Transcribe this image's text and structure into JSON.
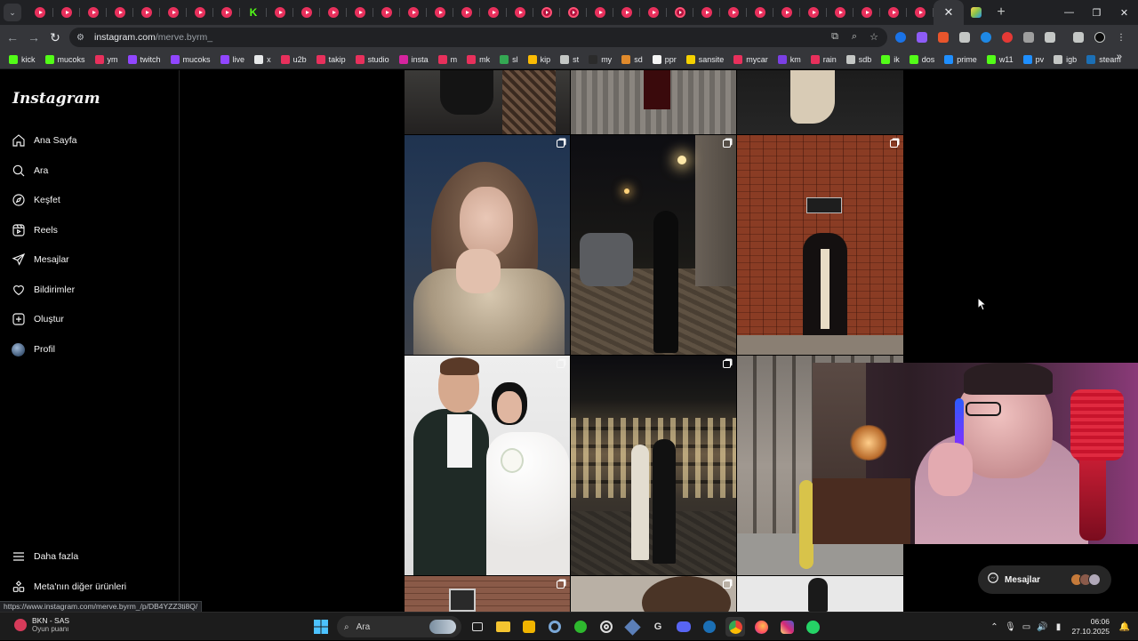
{
  "browser": {
    "url_host": "instagram.com",
    "url_path": "/merve.byrm_",
    "close_tab_glyph": "✕",
    "new_tab_glyph": "+",
    "status_url": "https://www.instagram.com/merve.byrm_/p/DB4YZZ3ti8Q/"
  },
  "bookmarks": [
    {
      "label": "kick",
      "color": "#53fc18"
    },
    {
      "label": "mucoks",
      "color": "#53fc18"
    },
    {
      "label": "ym",
      "color": "#e8305c"
    },
    {
      "label": "twitch",
      "color": "#9146ff"
    },
    {
      "label": "mucoks",
      "color": "#9146ff"
    },
    {
      "label": "live",
      "color": "#9146ff"
    },
    {
      "label": "x",
      "color": "#e7e9ea"
    },
    {
      "label": "u2b",
      "color": "#e8305c"
    },
    {
      "label": "takip",
      "color": "#e8305c"
    },
    {
      "label": "studio",
      "color": "#e8305c"
    },
    {
      "label": "insta",
      "color": "#d6249f"
    },
    {
      "label": "m",
      "color": "#e8305c"
    },
    {
      "label": "mk",
      "color": "#e8305c"
    },
    {
      "label": "sl",
      "color": "#34a853"
    },
    {
      "label": "kip",
      "color": "#fbbc04"
    },
    {
      "label": "st",
      "color": "#c4c7c5"
    },
    {
      "label": "my",
      "color": "#2b2b2b"
    },
    {
      "label": "sd",
      "color": "#e08a2c"
    },
    {
      "label": "ppr",
      "color": "#f5f5f5"
    },
    {
      "label": "sansite",
      "color": "#f5d100"
    },
    {
      "label": "mycar",
      "color": "#e8305c"
    },
    {
      "label": "km",
      "color": "#7b3fe4"
    },
    {
      "label": "rain",
      "color": "#e8305c"
    },
    {
      "label": "sdb",
      "color": "#c4c7c5"
    },
    {
      "label": "ik",
      "color": "#53fc18"
    },
    {
      "label": "dos",
      "color": "#53fc18"
    },
    {
      "label": "prime",
      "color": "#1f8fff"
    },
    {
      "label": "w11",
      "color": "#53fc18"
    },
    {
      "label": "pv",
      "color": "#1f8fff"
    },
    {
      "label": "igb",
      "color": "#c4c7c5"
    },
    {
      "label": "steam",
      "color": "#1b6fb5"
    }
  ],
  "instagram": {
    "logo": "Instagram",
    "nav": [
      {
        "label": "Ana Sayfa",
        "icon": "home-icon"
      },
      {
        "label": "Ara",
        "icon": "search-icon"
      },
      {
        "label": "Keşfet",
        "icon": "compass-icon"
      },
      {
        "label": "Reels",
        "icon": "reels-icon"
      },
      {
        "label": "Mesajlar",
        "icon": "send-icon"
      },
      {
        "label": "Bildirimler",
        "icon": "heart-icon"
      },
      {
        "label": "Oluştur",
        "icon": "plus-square-icon"
      },
      {
        "label": "Profil",
        "icon": "avatar"
      }
    ],
    "more": "Daha fazla",
    "meta": "Meta'nın diğer ürünleri",
    "messages_pill": "Mesajlar"
  },
  "taskbar": {
    "weather_title": "BKN - SAS",
    "weather_sub": "Oyun puanı",
    "search_label": "Ara",
    "time": "06:06",
    "date": "27.10.2025"
  }
}
